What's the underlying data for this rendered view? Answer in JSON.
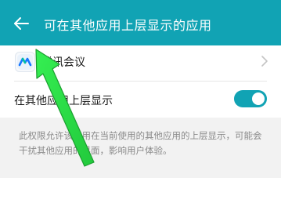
{
  "colors": {
    "accent": "#11a3b4",
    "arrow": "#2fe04a",
    "arrow_outline": "#1c9e30"
  },
  "header": {
    "back_icon": "back-arrow-icon",
    "title": "可在其他应用上层显示的应用"
  },
  "app_row": {
    "icon": "tencent-meeting-icon",
    "name": "腾讯会议",
    "chevron_icon": "chevron-right-icon"
  },
  "toggle": {
    "label": "在其他应用上层显示",
    "state": "on"
  },
  "description": {
    "text": "此权限允许该应用在当前使用的其他应用的上层显示，可能会干扰其他应用的界面，影响用户体验。"
  }
}
